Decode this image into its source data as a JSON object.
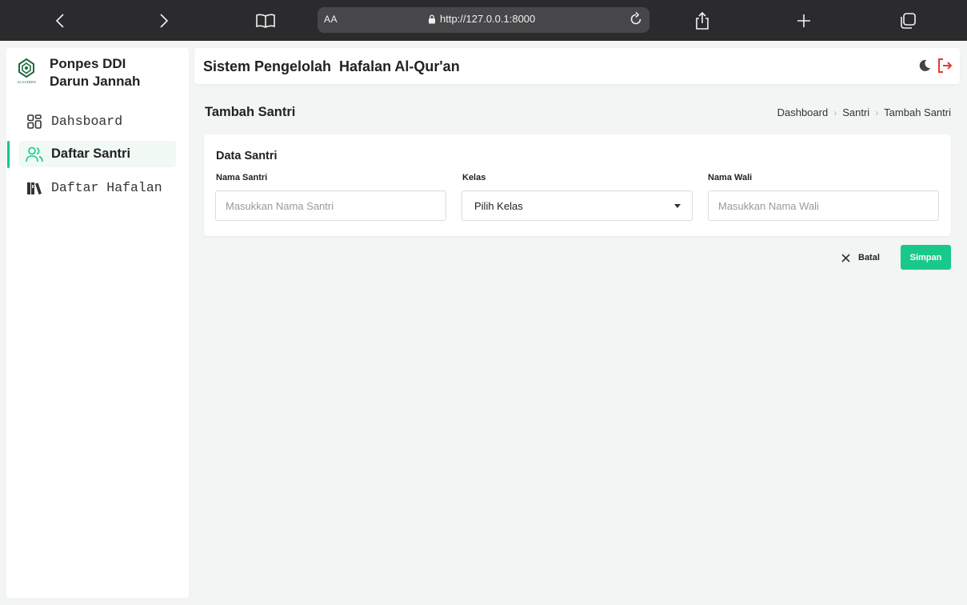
{
  "browser": {
    "text_size_label": "AA",
    "url": "http://127.0.0.1:8000"
  },
  "sidebar": {
    "brand_line1": "Ponpes DDI",
    "brand_line2": "Darun Jannah",
    "logo_text": "ALAUDDIN",
    "items": [
      {
        "label": "Dahsboard",
        "icon": "dashboard-icon",
        "active": false
      },
      {
        "label": "Daftar Santri",
        "icon": "users-icon",
        "active": true
      },
      {
        "label": "Daftar Hafalan",
        "icon": "books-icon",
        "active": false
      }
    ]
  },
  "header": {
    "title": "Sistem Pengelolah  Hafalan Al-Qur'an"
  },
  "page": {
    "title": "Tambah Santri",
    "breadcrumb": [
      "Dashboard",
      "Santri",
      "Tambah Santri"
    ]
  },
  "form": {
    "section_title": "Data Santri",
    "nama_santri": {
      "label": "Nama Santri",
      "placeholder": "Masukkan Nama Santri",
      "value": ""
    },
    "kelas": {
      "label": "Kelas",
      "selected": "Pilih Kelas"
    },
    "nama_wali": {
      "label": "Nama Wali",
      "placeholder": "Masukkan Nama Wali",
      "value": ""
    }
  },
  "actions": {
    "cancel_label": "Batal",
    "save_label": "Simpan"
  },
  "colors": {
    "accent": "#18c98a",
    "logout": "#e53935",
    "toolbar": "#2b2b2d"
  }
}
